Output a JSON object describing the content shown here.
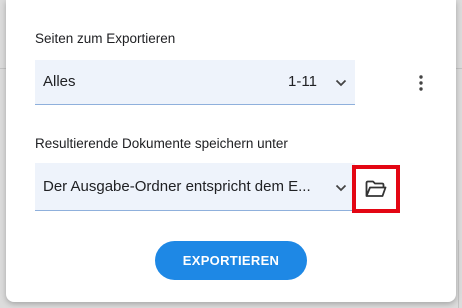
{
  "dialog": {
    "pages_label": "Seiten zum Exportieren",
    "pages_select": {
      "value": "Alles",
      "range": "1-11"
    },
    "location_label": "Resultierende Dokumente speichern unter",
    "location_select": {
      "value": "Der Ausgabe-Ordner entspricht dem E..."
    },
    "export_label": "EXPORTIEREN"
  },
  "icons": {
    "chevron": "chevron-down-icon",
    "more": "more-vert-icon",
    "folder": "folder-open-icon"
  },
  "colors": {
    "accent": "#1e88e5",
    "highlight": "#e30613",
    "field_bg": "#eef3fb"
  }
}
